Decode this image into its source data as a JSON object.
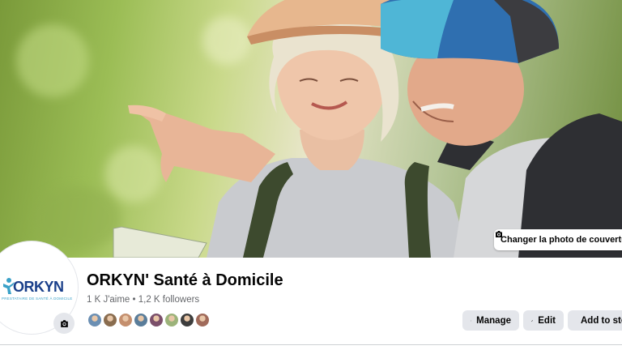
{
  "cover": {
    "change_cover_label": "Changer la photo de couverture"
  },
  "page": {
    "logo_text": "ORKYN",
    "logo_subtext": "PRESTATAIRE DE SANTÉ À DOMICILE",
    "title": "ORKYN' Santé à Domicile",
    "stats": "1 K J'aime • 1,2 K followers"
  },
  "friends": {
    "colors": [
      "#6b8fb3",
      "#8a6d4f",
      "#c48f6e",
      "#5a7d9a",
      "#7b4f6a",
      "#9cb37a",
      "#3d3d3d",
      "#a06a5a"
    ]
  },
  "actions": {
    "manage_label": "Manage",
    "edit_label": "Edit",
    "add_label": "Add to story"
  },
  "icons": {
    "camera": "camera-icon",
    "manage": "manage-icon",
    "edit": "pencil-icon",
    "add": "plus-circle-icon"
  }
}
